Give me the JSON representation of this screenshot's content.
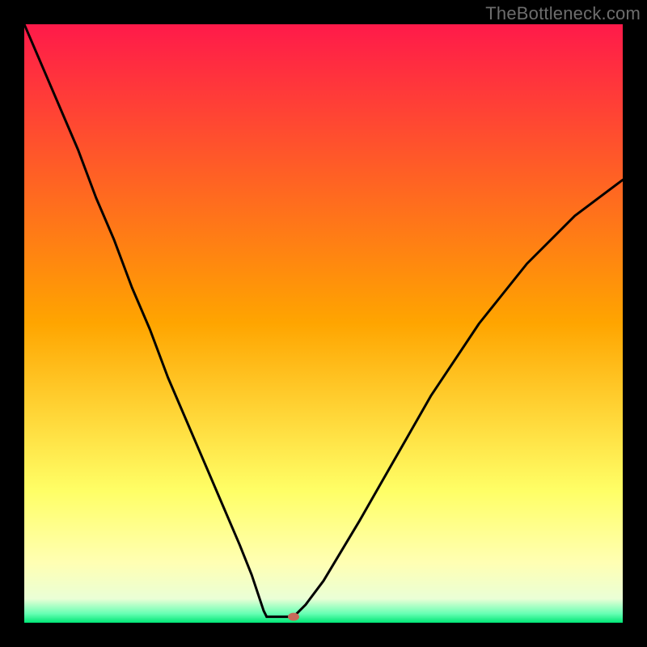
{
  "watermark": "TheBottleneck.com",
  "chart_data": {
    "type": "line",
    "title": "",
    "xlabel": "",
    "ylabel": "",
    "xlim": [
      0,
      100
    ],
    "ylim": [
      0,
      100
    ],
    "background_gradient": {
      "stops": [
        {
          "offset": 0.0,
          "color": "#ff1a4a"
        },
        {
          "offset": 0.5,
          "color": "#ffa500"
        },
        {
          "offset": 0.78,
          "color": "#ffff66"
        },
        {
          "offset": 0.9,
          "color": "#ffffb3"
        },
        {
          "offset": 0.96,
          "color": "#eaffd6"
        },
        {
          "offset": 0.985,
          "color": "#66ffb3"
        },
        {
          "offset": 1.0,
          "color": "#00e676"
        }
      ]
    },
    "series": [
      {
        "name": "left-branch",
        "x": [
          0,
          3,
          6,
          9,
          12,
          15,
          18,
          21,
          24,
          27,
          30,
          33,
          36,
          38,
          39,
          40,
          40.5
        ],
        "y": [
          100,
          93,
          86,
          79,
          71,
          64,
          56,
          49,
          41,
          34,
          27,
          20,
          13,
          8,
          5,
          2,
          1
        ]
      },
      {
        "name": "floor-segment",
        "x": [
          40.5,
          45
        ],
        "y": [
          1,
          1
        ]
      },
      {
        "name": "right-branch",
        "x": [
          45,
          47,
          50,
          53,
          56,
          60,
          64,
          68,
          72,
          76,
          80,
          84,
          88,
          92,
          96,
          100
        ],
        "y": [
          1,
          3,
          7,
          12,
          17,
          24,
          31,
          38,
          44,
          50,
          55,
          60,
          64,
          68,
          71,
          74
        ]
      }
    ],
    "marker": {
      "name": "bottleneck-marker",
      "x": 45,
      "y": 1,
      "rx": 7,
      "ry": 5,
      "fill": "#c86a5a"
    }
  }
}
